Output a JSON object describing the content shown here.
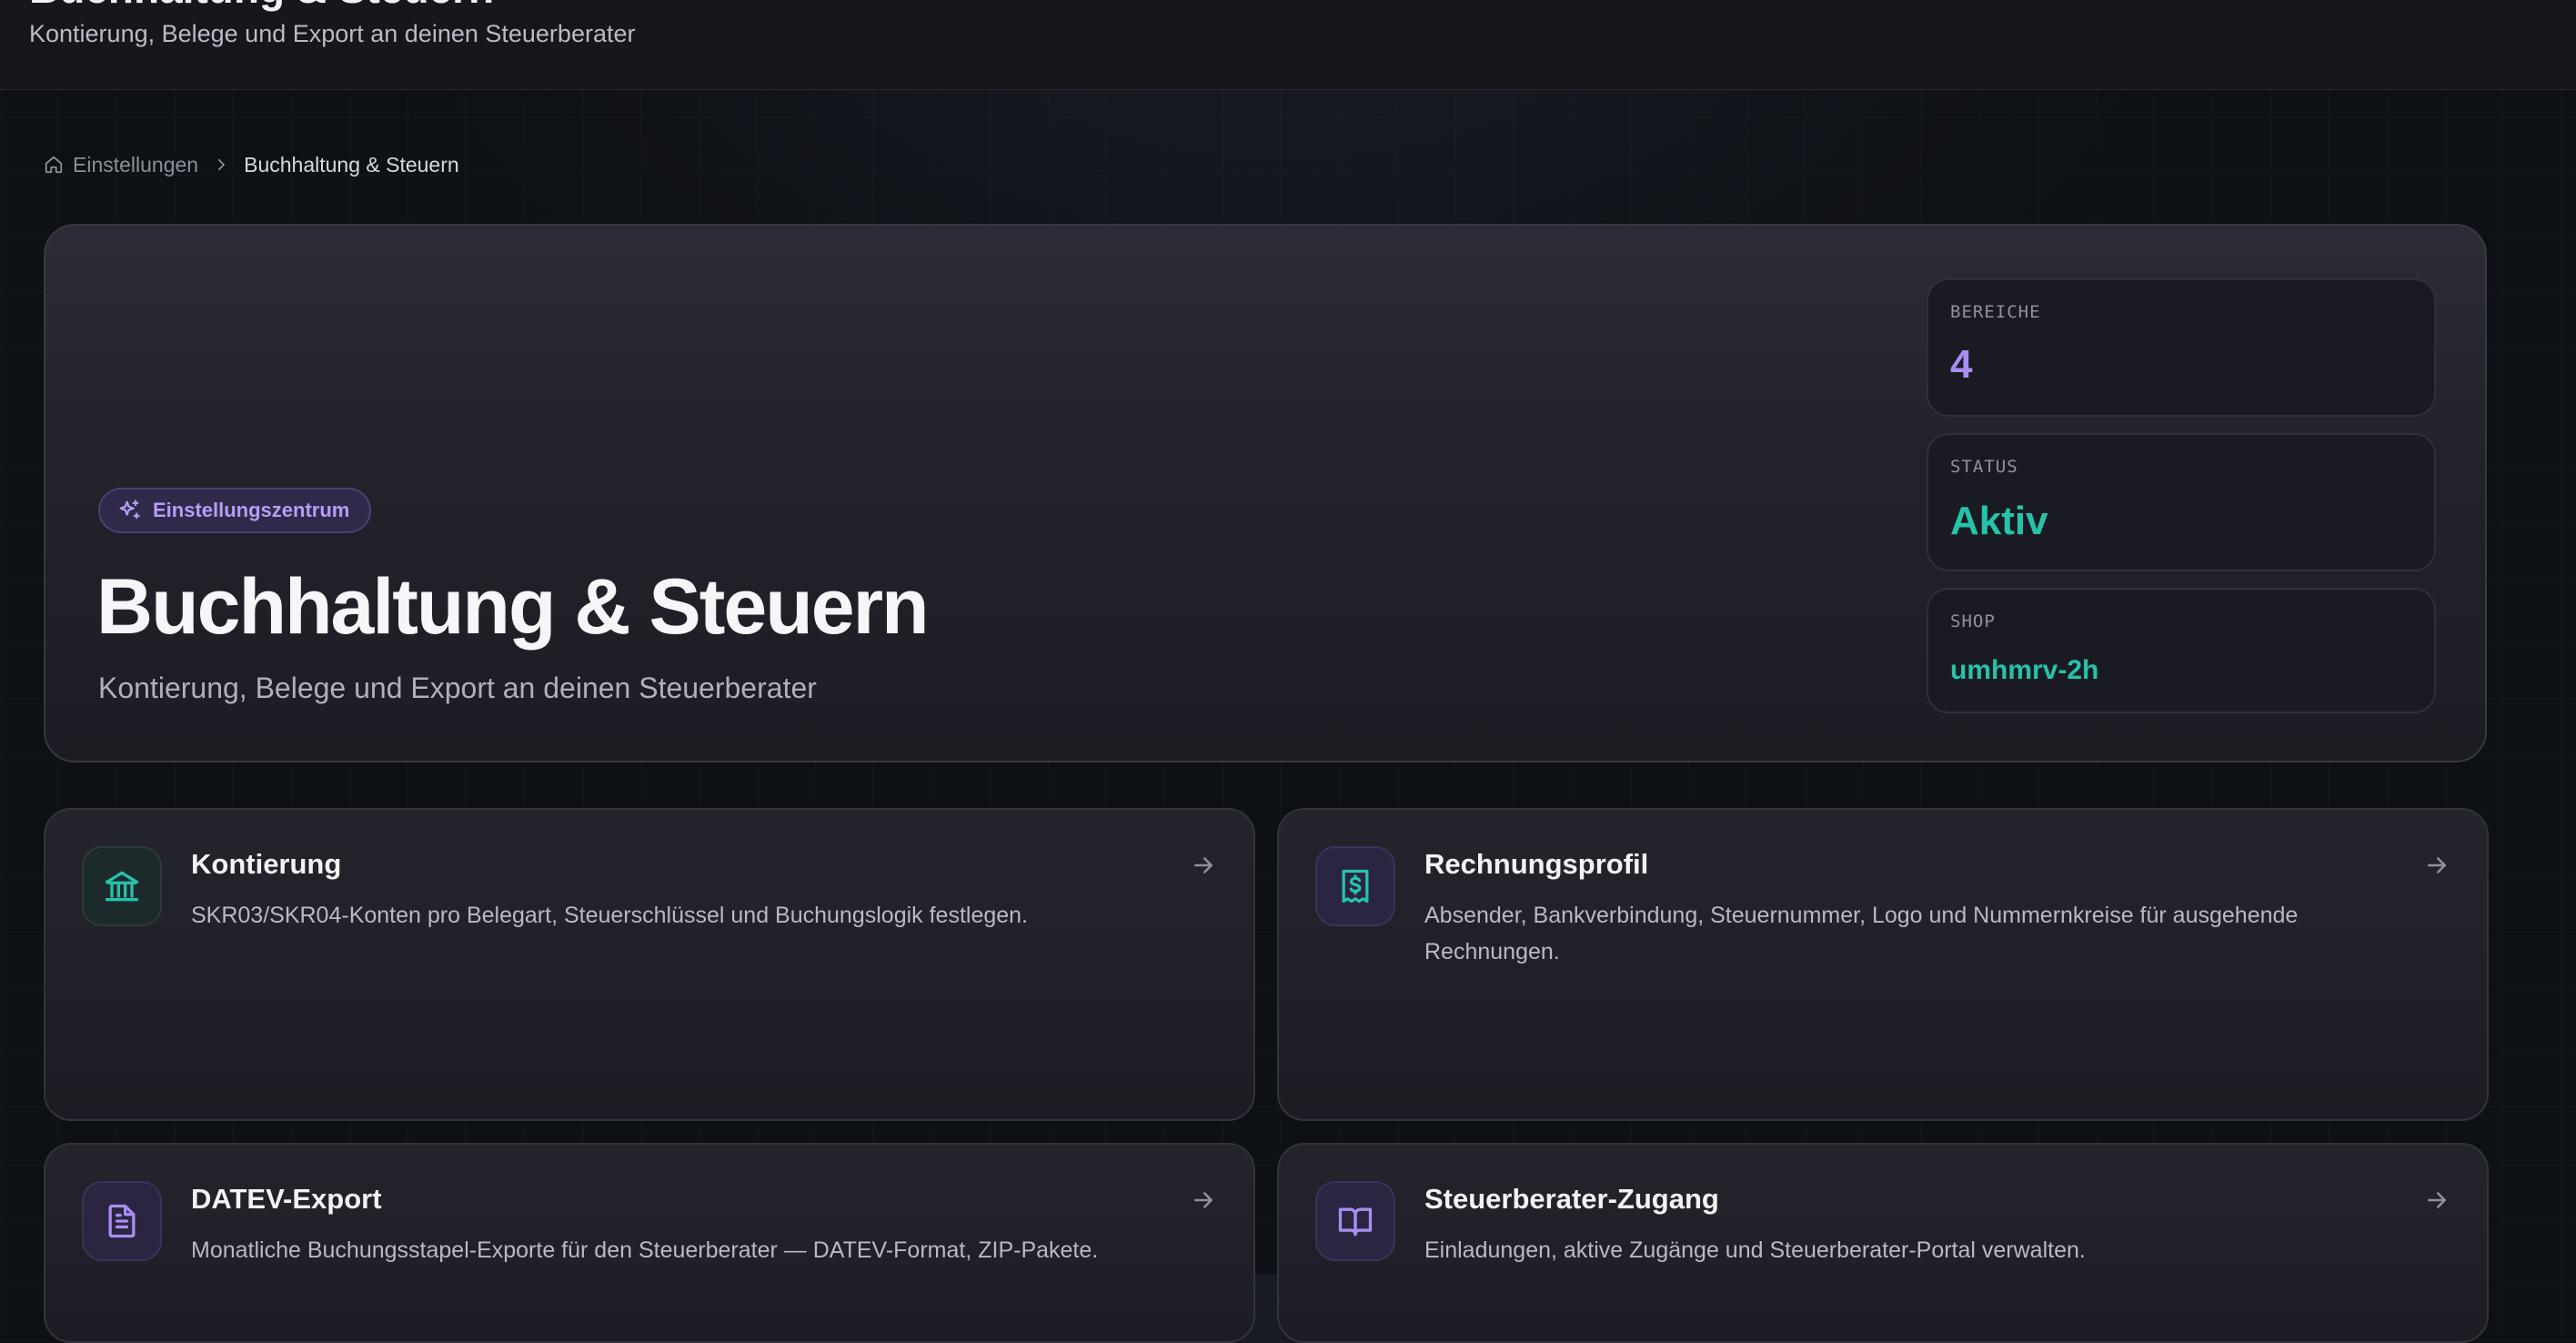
{
  "header": {
    "title": "Buchhaltung & Steuern",
    "subtitle": "Kontierung, Belege und Export an deinen Steuerberater"
  },
  "breadcrumb": {
    "parent": "Einstellungen",
    "current": "Buchhaltung & Steuern"
  },
  "hero": {
    "badge": "Einstellungszentrum",
    "title": "Buchhaltung & Steuern",
    "subtitle": "Kontierung, Belege und Export an deinen Steuerberater",
    "stats": [
      {
        "label": "BEREICHE",
        "value": "4"
      },
      {
        "label": "STATUS",
        "value": "Aktiv"
      },
      {
        "label": "SHOP",
        "value": "umhmrv-2h"
      }
    ]
  },
  "cards": [
    {
      "title": "Kontierung",
      "description": "SKR03/SKR04-Konten pro Belegart, Steuerschlüssel und Buchungslogik festlegen.",
      "icon": "bank-icon"
    },
    {
      "title": "Rechnungsprofil",
      "description": "Absender, Bankverbindung, Steuernummer, Logo und Nummernkreise für ausgehende Rechnungen.",
      "icon": "receipt-icon"
    },
    {
      "title": "DATEV-Export",
      "description": "Monatliche Buchungsstapel-Exporte für den Steuerberater — DATEV-Format, ZIP-Pakete.",
      "icon": "document-icon"
    },
    {
      "title": "Steuerberater-Zugang",
      "description": "Einladungen, aktive Zugänge und Steuerberater-Portal verwalten.",
      "icon": "book-icon"
    }
  ],
  "colors": {
    "accent_purple": "#a98ef0",
    "accent_teal": "#27c2aa",
    "background": "#0d1014",
    "card": "#22222b"
  }
}
